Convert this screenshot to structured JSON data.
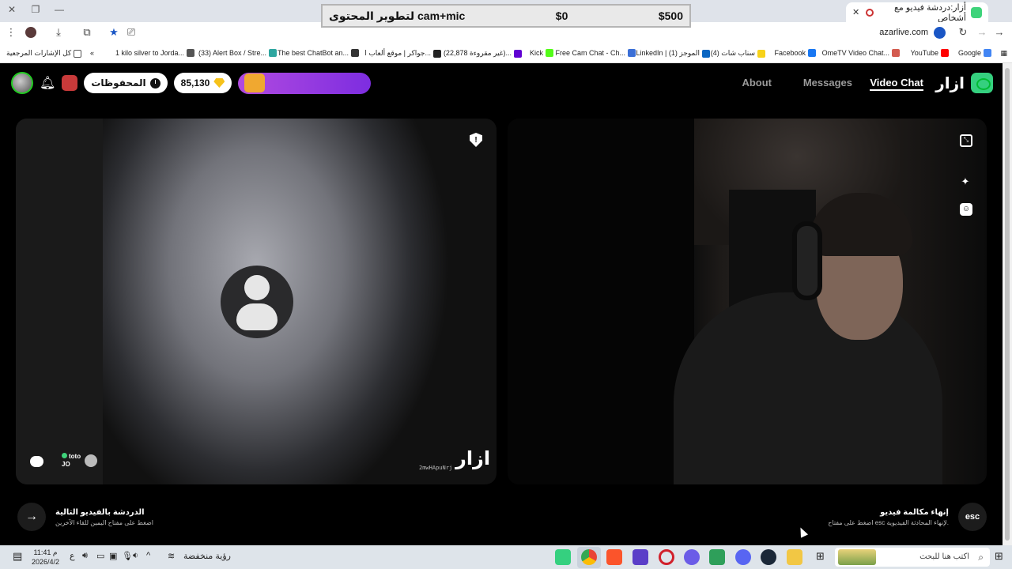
{
  "browser": {
    "tab_title": "أزار:دردشة فيديو مع أشخاص",
    "url": "azarlive.com",
    "bookmarks": [
      {
        "label": "Google",
        "color": "#4285f4"
      },
      {
        "label": "YouTube",
        "color": "#ff0000"
      },
      {
        "label": "OmeTV Video Chat...",
        "color": "#d35b4f"
      },
      {
        "label": "Facebook",
        "color": "#1877f2"
      },
      {
        "label": "(4) سناب شات",
        "color": "#f7d21a"
      },
      {
        "label": "LinkedIn | (1) الموجز",
        "color": "#0a66c2"
      },
      {
        "label": "Free Cam Chat - Ch...",
        "color": "#3b6fd6"
      },
      {
        "label": "Kick",
        "color": "#53fc18"
      },
      {
        "label": "(22,878 غير مقروءة)...",
        "color": "#6001d2"
      },
      {
        "label": "جواكر | موقع ألعاب ا...",
        "color": "#222222"
      },
      {
        "label": "The best ChatBot an...",
        "color": "#333333"
      },
      {
        "label": "(33) Alert Box / Stre...",
        "color": "#2ea6a0"
      },
      {
        "label": "1 kilo silver to Jorda...",
        "color": "#555555"
      },
      {
        "label": "كل الإشارات المرجعية",
        "color": "#555555"
      }
    ]
  },
  "overlay": {
    "goal_amount": "$500",
    "current_amount": "$0",
    "goal_title": "لتطوير المحتوى cam+mic"
  },
  "header": {
    "brand_text": "ازار",
    "nav": [
      {
        "label": "Video Chat",
        "active": true
      },
      {
        "label": "Messages",
        "active": false
      },
      {
        "label": "About",
        "active": false
      }
    ],
    "saved_label": "المحفوظات",
    "gems_count": "85,130"
  },
  "left_panel": {
    "partner_name": "toto",
    "partner_country": "JO",
    "session_code": "2mwHApuNrj",
    "watermark": "ازار"
  },
  "bottom": {
    "next_title": "الدردشة بالفيديو التالية",
    "next_subtitle": "اضغط على مفتاح اليمين للقاء الآخرين",
    "end_title": "إنهاء مكالمة فيديو",
    "end_subtitle": "اضغط على مفتاح esc لإنهاء المحادثة الفيديوية.",
    "esc_label": "esc"
  },
  "taskbar": {
    "search_placeholder": "اكتب هنا للبحث",
    "weather": "رؤية منخفضة",
    "lang": "ع",
    "time": "11:41 م",
    "date": "2026/4/2"
  }
}
